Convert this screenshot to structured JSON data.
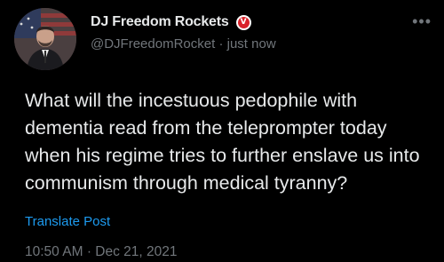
{
  "author": {
    "display_name": "DJ Freedom Rockets",
    "badge_letter": "V",
    "badge_color": "#d9222a",
    "handle": "@DJFreedomRocket",
    "separator": "·",
    "time_ago": "just now",
    "avatar": "profile-photo"
  },
  "more_icon": "•••",
  "tweet": {
    "text": "What will the incestuous pedophile with dementia read from the teleprompter today when his regime tries to further enslave us into communism through medical tyranny?"
  },
  "translate_label": "Translate Post",
  "timestamp": {
    "time": "10:50 AM",
    "separator": "·",
    "date": "Dec 21, 2021"
  },
  "colors": {
    "background": "#000000",
    "text": "#e7e9ea",
    "secondary": "#71767b",
    "link": "#1d9bf0"
  }
}
